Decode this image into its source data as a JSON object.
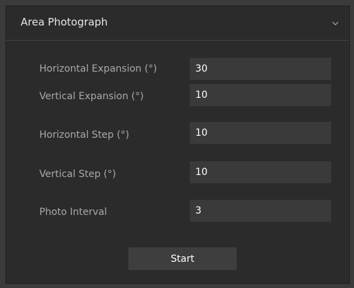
{
  "panel": {
    "title": "Area Photograph",
    "collapse_icon": "chevron-down-icon"
  },
  "fields": [
    {
      "label": "Horizontal Expansion (°)",
      "value": "30"
    },
    {
      "label": "Vertical Expansion (°)",
      "value": "10"
    },
    {
      "label": "Horizontal Step (°)",
      "value": "10"
    },
    {
      "label": "Vertical Step (°)",
      "value": "10"
    },
    {
      "label": "Photo Interval",
      "value": "3"
    }
  ],
  "actions": {
    "start_label": "Start"
  }
}
